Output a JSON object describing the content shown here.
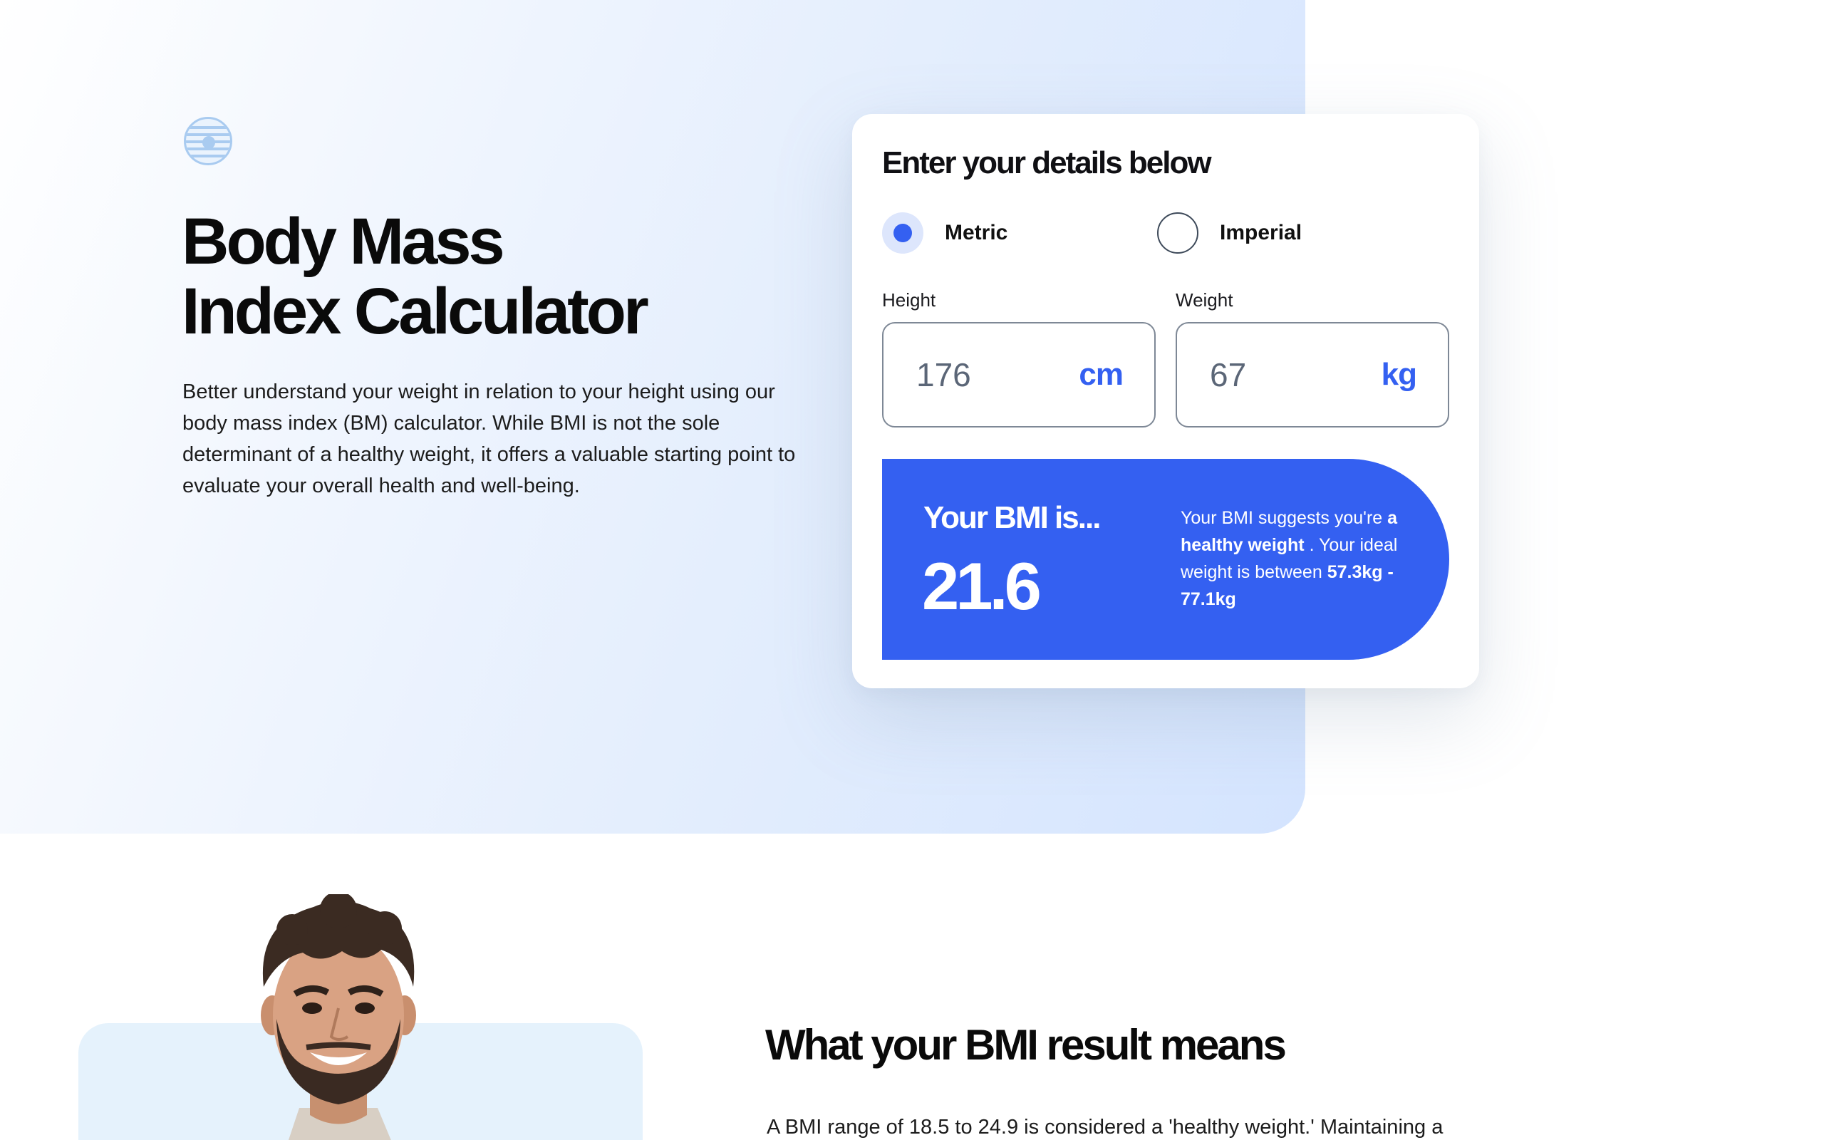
{
  "hero": {
    "title_line1": "Body Mass",
    "title_line2": "Index Calculator",
    "description": "Better understand your weight in relation to your height using our body mass index (BM) calculator. While BMI is not the sole determinant of a healthy weight, it offers a valuable starting point to evaluate your overall health and well-being."
  },
  "calculator": {
    "title": "Enter your details below",
    "units": {
      "selected": "metric",
      "metric_label": "Metric",
      "imperial_label": "Imperial"
    },
    "height": {
      "label": "Height",
      "value": "176",
      "unit": "cm"
    },
    "weight": {
      "label": "Weight",
      "value": "67",
      "unit": "kg"
    },
    "result": {
      "heading": "Your BMI is...",
      "value": "21.6",
      "text_prefix": "Your BMI suggests you're",
      "classification": "a healthy weight",
      "text_middle": ". Your ideal weight is between",
      "ideal_range": "57.3kg - 77.1kg"
    }
  },
  "meaning": {
    "title": "What your BMI result means",
    "description": "A BMI range of 18.5 to 24.9 is considered a 'healthy weight.' Maintaining a"
  },
  "colors": {
    "accent": "#3460f1",
    "hero_gradient_end": "#d4e4fe",
    "photo_card_bg": "#e5f2fc"
  },
  "icons": {
    "logo": "striped-circle-logo"
  }
}
